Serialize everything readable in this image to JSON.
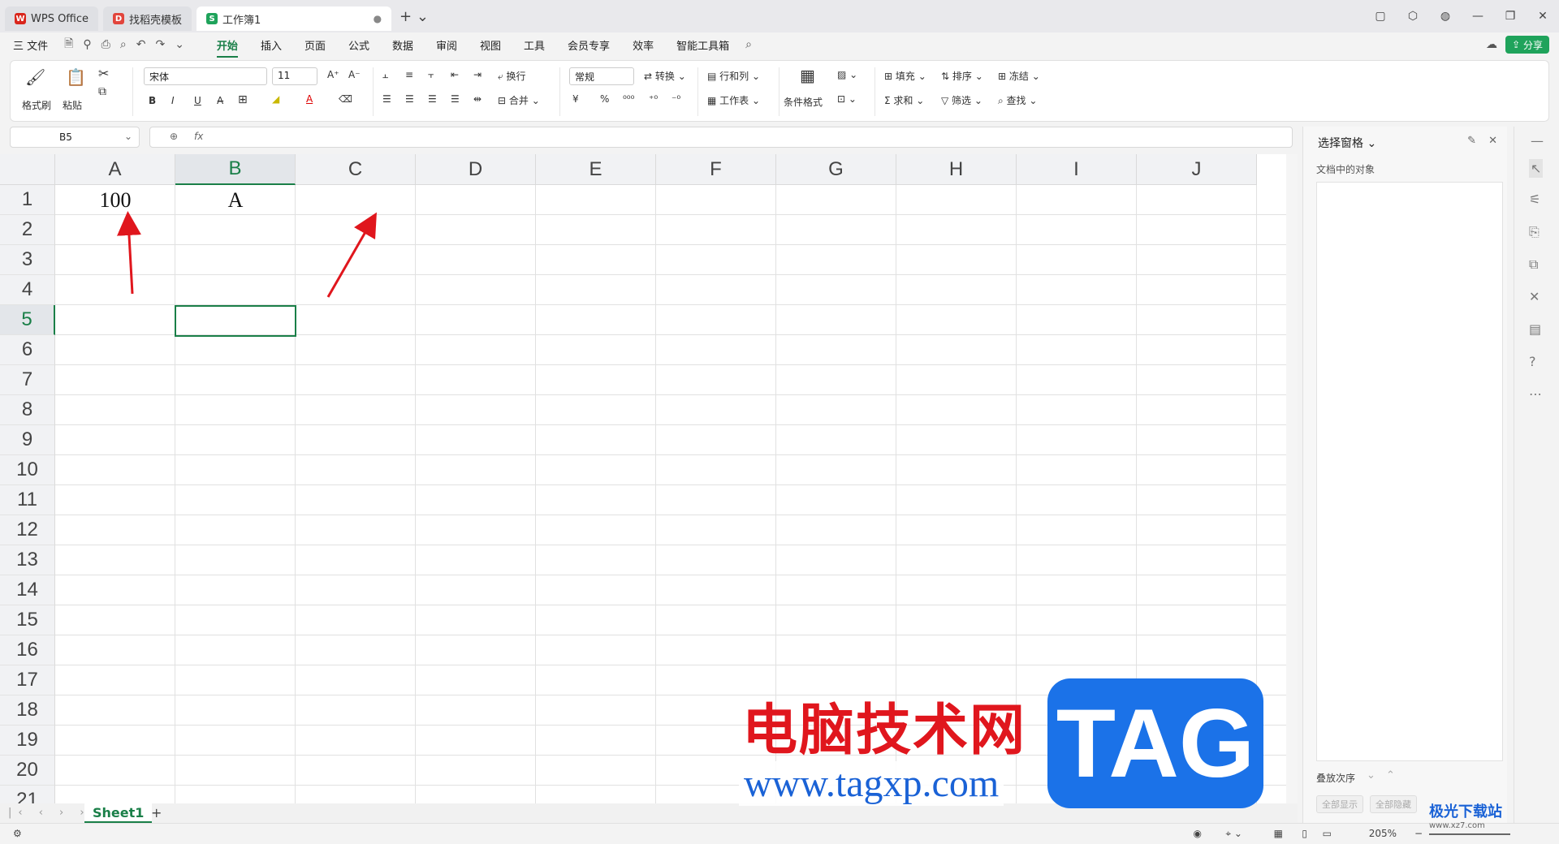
{
  "titlebar": {
    "tabs": [
      {
        "label": "WPS Office"
      },
      {
        "label": "找稻壳模板"
      },
      {
        "label": "工作簿1",
        "badge": "S"
      }
    ]
  },
  "menu": {
    "file": "三 文件",
    "items": [
      "开始",
      "插入",
      "页面",
      "公式",
      "数据",
      "审阅",
      "视图",
      "工具",
      "会员专享",
      "效率",
      "智能工具箱"
    ],
    "share": "分享"
  },
  "ribbon": {
    "format_painter": "格式刷",
    "paste": "粘贴",
    "font_name": "宋体",
    "font_size": "11",
    "wrap": "换行",
    "merge": "合并",
    "number_format": "常规",
    "convert": "转换",
    "rowcol": "行和列",
    "worksheet": "工作表",
    "cond_format": "条件格式",
    "fill": "填充",
    "sort": "排序",
    "freeze": "冻结",
    "sum": "求和",
    "filter": "筛选",
    "find": "查找",
    "bold": "B",
    "italic": "I",
    "underline": "U",
    "currency": "¥",
    "percent": "%"
  },
  "formula_bar": {
    "name_box": "B5",
    "fx": "fx",
    "content": ""
  },
  "columns": [
    "A",
    "B",
    "C",
    "D",
    "E",
    "F",
    "G",
    "H",
    "I",
    "J"
  ],
  "rows": [
    "1",
    "2",
    "3",
    "4",
    "5",
    "6",
    "7",
    "8",
    "9",
    "10",
    "11",
    "12",
    "13",
    "14",
    "15",
    "16",
    "17",
    "18",
    "19",
    "20",
    "21"
  ],
  "cells": {
    "A1": "100",
    "B1": "A"
  },
  "sheets": [
    "Sheet1"
  ],
  "pane": {
    "title": "选择窗格",
    "subtitle": "文档中的对象",
    "order_label": "叠放次序",
    "show_all": "全部显示",
    "hide_all": "全部隐藏"
  },
  "status": {
    "zoom": "205%"
  },
  "watermark": {
    "cn": "电脑技术网",
    "url": "www.tagxp.com",
    "tag": "TAG",
    "corner": "极光下载站",
    "corner_sub": "www.xz7.com"
  },
  "colors": {
    "accent": "#1a7f48",
    "arrow": "#e0161d"
  }
}
